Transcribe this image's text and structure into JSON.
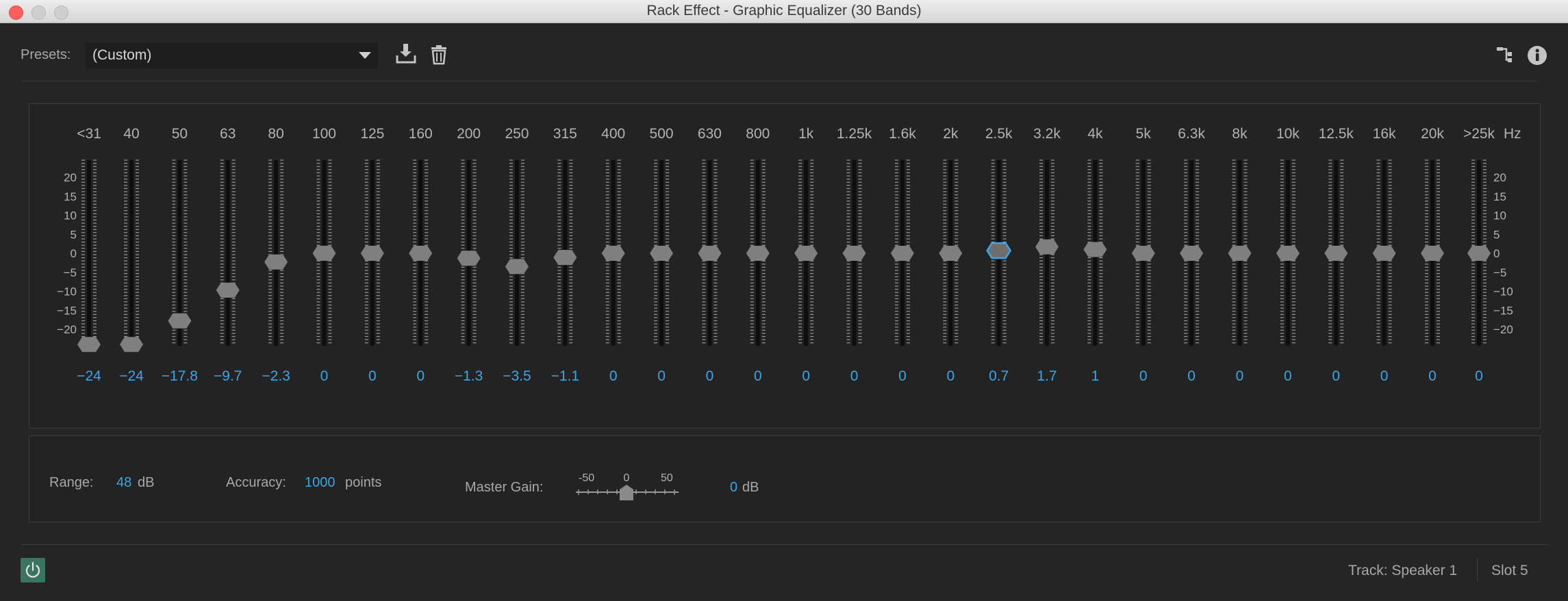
{
  "window": {
    "title": "Rack Effect - Graphic Equalizer (30 Bands)"
  },
  "presets": {
    "label": "Presets:",
    "value": "(Custom)",
    "save_icon": "download-icon",
    "delete_icon": "trash-icon",
    "routing_icon": "routing-icon",
    "info_icon": "info-icon"
  },
  "equalizer": {
    "hz_label": "Hz",
    "bands": [
      {
        "freq": "<31",
        "gain": -24
      },
      {
        "freq": "40",
        "gain": -24
      },
      {
        "freq": "50",
        "gain": -17.8
      },
      {
        "freq": "63",
        "gain": -9.7
      },
      {
        "freq": "80",
        "gain": -2.3
      },
      {
        "freq": "100",
        "gain": 0
      },
      {
        "freq": "125",
        "gain": 0
      },
      {
        "freq": "160",
        "gain": 0
      },
      {
        "freq": "200",
        "gain": -1.3
      },
      {
        "freq": "250",
        "gain": -3.5
      },
      {
        "freq": "315",
        "gain": -1.1
      },
      {
        "freq": "400",
        "gain": 0
      },
      {
        "freq": "500",
        "gain": 0
      },
      {
        "freq": "630",
        "gain": 0
      },
      {
        "freq": "800",
        "gain": 0
      },
      {
        "freq": "1k",
        "gain": 0
      },
      {
        "freq": "1.25k",
        "gain": 0
      },
      {
        "freq": "1.6k",
        "gain": 0
      },
      {
        "freq": "2k",
        "gain": 0
      },
      {
        "freq": "2.5k",
        "gain": 0.7,
        "selected": true
      },
      {
        "freq": "3.2k",
        "gain": 1.7
      },
      {
        "freq": "4k",
        "gain": 1
      },
      {
        "freq": "5k",
        "gain": 0
      },
      {
        "freq": "6.3k",
        "gain": 0
      },
      {
        "freq": "8k",
        "gain": 0
      },
      {
        "freq": "10k",
        "gain": 0
      },
      {
        "freq": "12.5k",
        "gain": 0
      },
      {
        "freq": "16k",
        "gain": 0
      },
      {
        "freq": "20k",
        "gain": 0
      },
      {
        "freq": ">25k",
        "gain": 0
      }
    ],
    "db_scale_labels": [
      "20",
      "15",
      "10",
      "5",
      "0",
      "-5",
      "-10",
      "-15",
      "-20"
    ],
    "db_range": [
      -24,
      24
    ]
  },
  "settings": {
    "range_label": "Range:",
    "range_value": "48",
    "range_unit": "dB",
    "accuracy_label": "Accuracy:",
    "accuracy_value": "1000",
    "accuracy_unit": "points",
    "master_gain_label": "Master Gain:",
    "master_gain_scale": [
      "-50",
      "0",
      "50"
    ],
    "master_gain_value": "0",
    "master_gain_unit": "dB"
  },
  "footer": {
    "power_icon": "power-icon",
    "track": "Track: Speaker 1",
    "slot": "Slot 5"
  },
  "colors": {
    "accent": "#3aa6e8",
    "power_bg": "#3b7561",
    "thumb": "#7f7f7f",
    "selected_outline": "#3aa6e8"
  }
}
